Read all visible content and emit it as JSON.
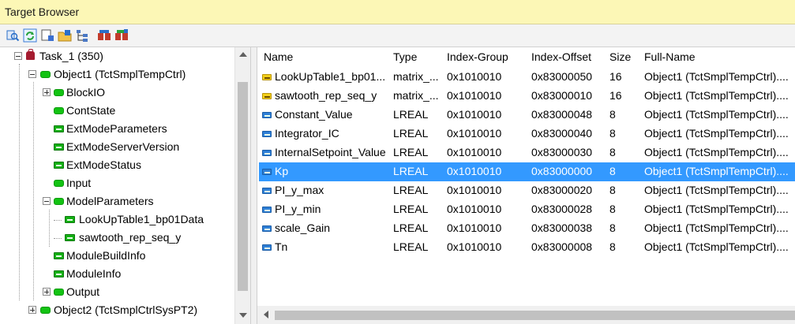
{
  "window": {
    "title": "Target Browser"
  },
  "toolbar": {
    "buttons": [
      {
        "name": "find-icon",
        "color": "#2a6fc9"
      },
      {
        "name": "refresh-icon",
        "color": "#27a33b"
      },
      {
        "name": "view-icon",
        "color": "#3b6fd0"
      },
      {
        "name": "open-folder-icon",
        "color": "#e0a72a"
      },
      {
        "name": "tree-structure-icon",
        "color": "#4a78c4"
      },
      {
        "name": "add-watch-icon",
        "color": "#c23b2b"
      },
      {
        "name": "add-watch-all-icon",
        "color": "#c23b2b"
      }
    ]
  },
  "tree": {
    "items": [
      {
        "label": "Task_1 (350)",
        "icon": "task-icon",
        "expander": "minus"
      },
      {
        "label": "Object1 (TctSmplTempCtrl)",
        "icon": "object-icon",
        "expander": "minus"
      },
      {
        "label": "BlockIO",
        "icon": "object-icon",
        "expander": "plus"
      },
      {
        "label": "ContState",
        "icon": "object-icon",
        "expander": ""
      },
      {
        "label": "ExtModeParameters",
        "icon": "variable-icon",
        "expander": ""
      },
      {
        "label": "ExtModeServerVersion",
        "icon": "variable-icon",
        "expander": ""
      },
      {
        "label": "ExtModeStatus",
        "icon": "variable-icon",
        "expander": ""
      },
      {
        "label": "Input",
        "icon": "object-icon",
        "expander": ""
      },
      {
        "label": "ModelParameters",
        "icon": "object-icon",
        "expander": "minus"
      },
      {
        "label": "LookUpTable1_bp01Data",
        "icon": "variable-icon",
        "expander": ""
      },
      {
        "label": "sawtooth_rep_seq_y",
        "icon": "variable-icon",
        "expander": ""
      },
      {
        "label": "ModuleBuildInfo",
        "icon": "variable-icon",
        "expander": ""
      },
      {
        "label": "ModuleInfo",
        "icon": "variable-icon",
        "expander": ""
      },
      {
        "label": "Output",
        "icon": "object-icon",
        "expander": "plus"
      },
      {
        "label": "Object2 (TctSmplCtrlSysPT2)",
        "icon": "object-icon",
        "expander": "plus"
      }
    ]
  },
  "table": {
    "columns": [
      "Name",
      "Type",
      "Index-Group",
      "Index-Offset",
      "Size",
      "Full-Name"
    ],
    "rows": [
      {
        "name": "LookUpTable1_bp01...",
        "type": "matrix_...",
        "group": "0x1010010",
        "offset": "0x83000050",
        "size": "16",
        "full": "Object1 (TctSmplTempCtrl)....",
        "icon": "yellow"
      },
      {
        "name": "sawtooth_rep_seq_y",
        "type": "matrix_...",
        "group": "0x1010010",
        "offset": "0x83000010",
        "size": "16",
        "full": "Object1 (TctSmplTempCtrl)....",
        "icon": "yellow"
      },
      {
        "name": "Constant_Value",
        "type": "LREAL",
        "group": "0x1010010",
        "offset": "0x83000048",
        "size": "8",
        "full": "Object1 (TctSmplTempCtrl)....",
        "icon": "blue"
      },
      {
        "name": "Integrator_IC",
        "type": "LREAL",
        "group": "0x1010010",
        "offset": "0x83000040",
        "size": "8",
        "full": "Object1 (TctSmplTempCtrl)....",
        "icon": "blue"
      },
      {
        "name": "InternalSetpoint_Value",
        "type": "LREAL",
        "group": "0x1010010",
        "offset": "0x83000030",
        "size": "8",
        "full": "Object1 (TctSmplTempCtrl)....",
        "icon": "blue"
      },
      {
        "name": "Kp",
        "type": "LREAL",
        "group": "0x1010010",
        "offset": "0x83000000",
        "size": "8",
        "full": "Object1 (TctSmplTempCtrl)....",
        "icon": "blue",
        "selected": true
      },
      {
        "name": "PI_y_max",
        "type": "LREAL",
        "group": "0x1010010",
        "offset": "0x83000020",
        "size": "8",
        "full": "Object1 (TctSmplTempCtrl)....",
        "icon": "blue"
      },
      {
        "name": "PI_y_min",
        "type": "LREAL",
        "group": "0x1010010",
        "offset": "0x83000028",
        "size": "8",
        "full": "Object1 (TctSmplTempCtrl)....",
        "icon": "blue"
      },
      {
        "name": "scale_Gain",
        "type": "LREAL",
        "group": "0x1010010",
        "offset": "0x83000038",
        "size": "8",
        "full": "Object1 (TctSmplTempCtrl)....",
        "icon": "blue"
      },
      {
        "name": "Tn",
        "type": "LREAL",
        "group": "0x1010010",
        "offset": "0x83000008",
        "size": "8",
        "full": "Object1 (TctSmplTempCtrl)....",
        "icon": "blue"
      }
    ]
  },
  "colors": {
    "selection": "#3399ff",
    "titlebar": "#fcf7b6"
  }
}
